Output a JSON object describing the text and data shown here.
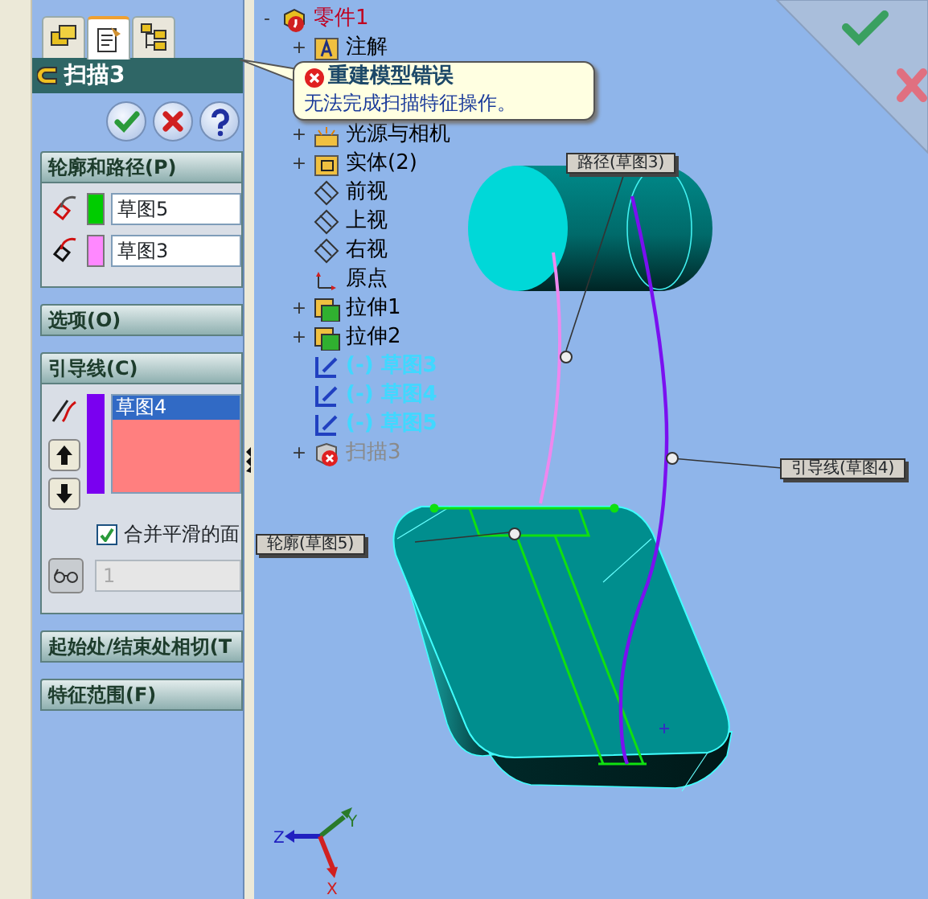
{
  "panel_tabs": [
    {
      "kind": "features",
      "selected": false
    },
    {
      "kind": "properties",
      "selected": true
    },
    {
      "kind": "config",
      "selected": false
    }
  ],
  "feature": {
    "title": "扫描3"
  },
  "actions": [
    {
      "kind": "ok"
    },
    {
      "kind": "cancel"
    },
    {
      "kind": "help"
    }
  ],
  "sections": [
    {
      "kind": "profile-path",
      "title": "轮廓和路径(P)",
      "expanded": true,
      "rows": [
        {
          "kind": "profile",
          "color": "#00cc00",
          "value": "草图5"
        },
        {
          "kind": "path",
          "color": "#ff88ff",
          "value": "草图3"
        }
      ]
    },
    {
      "title": "选项(O)",
      "expanded": false
    },
    {
      "kind": "guide",
      "title": "引导线(C)",
      "expanded": true,
      "color": "#7a00f0",
      "items": [
        {
          "label": "草图4",
          "selected": true
        }
      ],
      "merge": {
        "label": "合并平滑的面",
        "checked": true
      },
      "count": {
        "value": "1",
        "disabled": true
      }
    },
    {
      "title": "起始处/结束处相切(T",
      "expanded": false
    },
    {
      "title": "特征范围(F)",
      "expanded": false
    }
  ],
  "tree": {
    "root": {
      "toggle": "-",
      "label": "零件1",
      "kind": "part"
    },
    "items": [
      {
        "toggle": "+",
        "label": "注解",
        "kind": "annotation"
      },
      {
        "toggle": "+",
        "label": "光源与相机",
        "kind": "lights"
      },
      {
        "toggle": "+",
        "label": "实体(2)",
        "kind": "bodies"
      },
      {
        "label": "前视",
        "kind": "plane"
      },
      {
        "label": "上视",
        "kind": "plane"
      },
      {
        "label": "右视",
        "kind": "plane"
      },
      {
        "label": "原点",
        "kind": "origin"
      },
      {
        "toggle": "+",
        "label": "拉伸1",
        "kind": "extrude"
      },
      {
        "toggle": "+",
        "label": "拉伸2",
        "kind": "extrude"
      },
      {
        "label": "(-) 草图3",
        "kind": "sketch"
      },
      {
        "label": "(-) 草图4",
        "kind": "sketch"
      },
      {
        "label": "(-) 草图5",
        "kind": "sketch"
      },
      {
        "toggle": "+",
        "label": "扫描3",
        "kind": "error"
      }
    ]
  },
  "tooltip": {
    "title": "重建模型错误",
    "message": "无法完成扫描特征操作。"
  },
  "callouts": [
    {
      "text": "路径(草图3)"
    },
    {
      "text": "引导线(草图4)"
    },
    {
      "text": "轮廓(草图5)"
    }
  ],
  "triad": {
    "x": "X",
    "y": "Y",
    "z": "Z"
  }
}
